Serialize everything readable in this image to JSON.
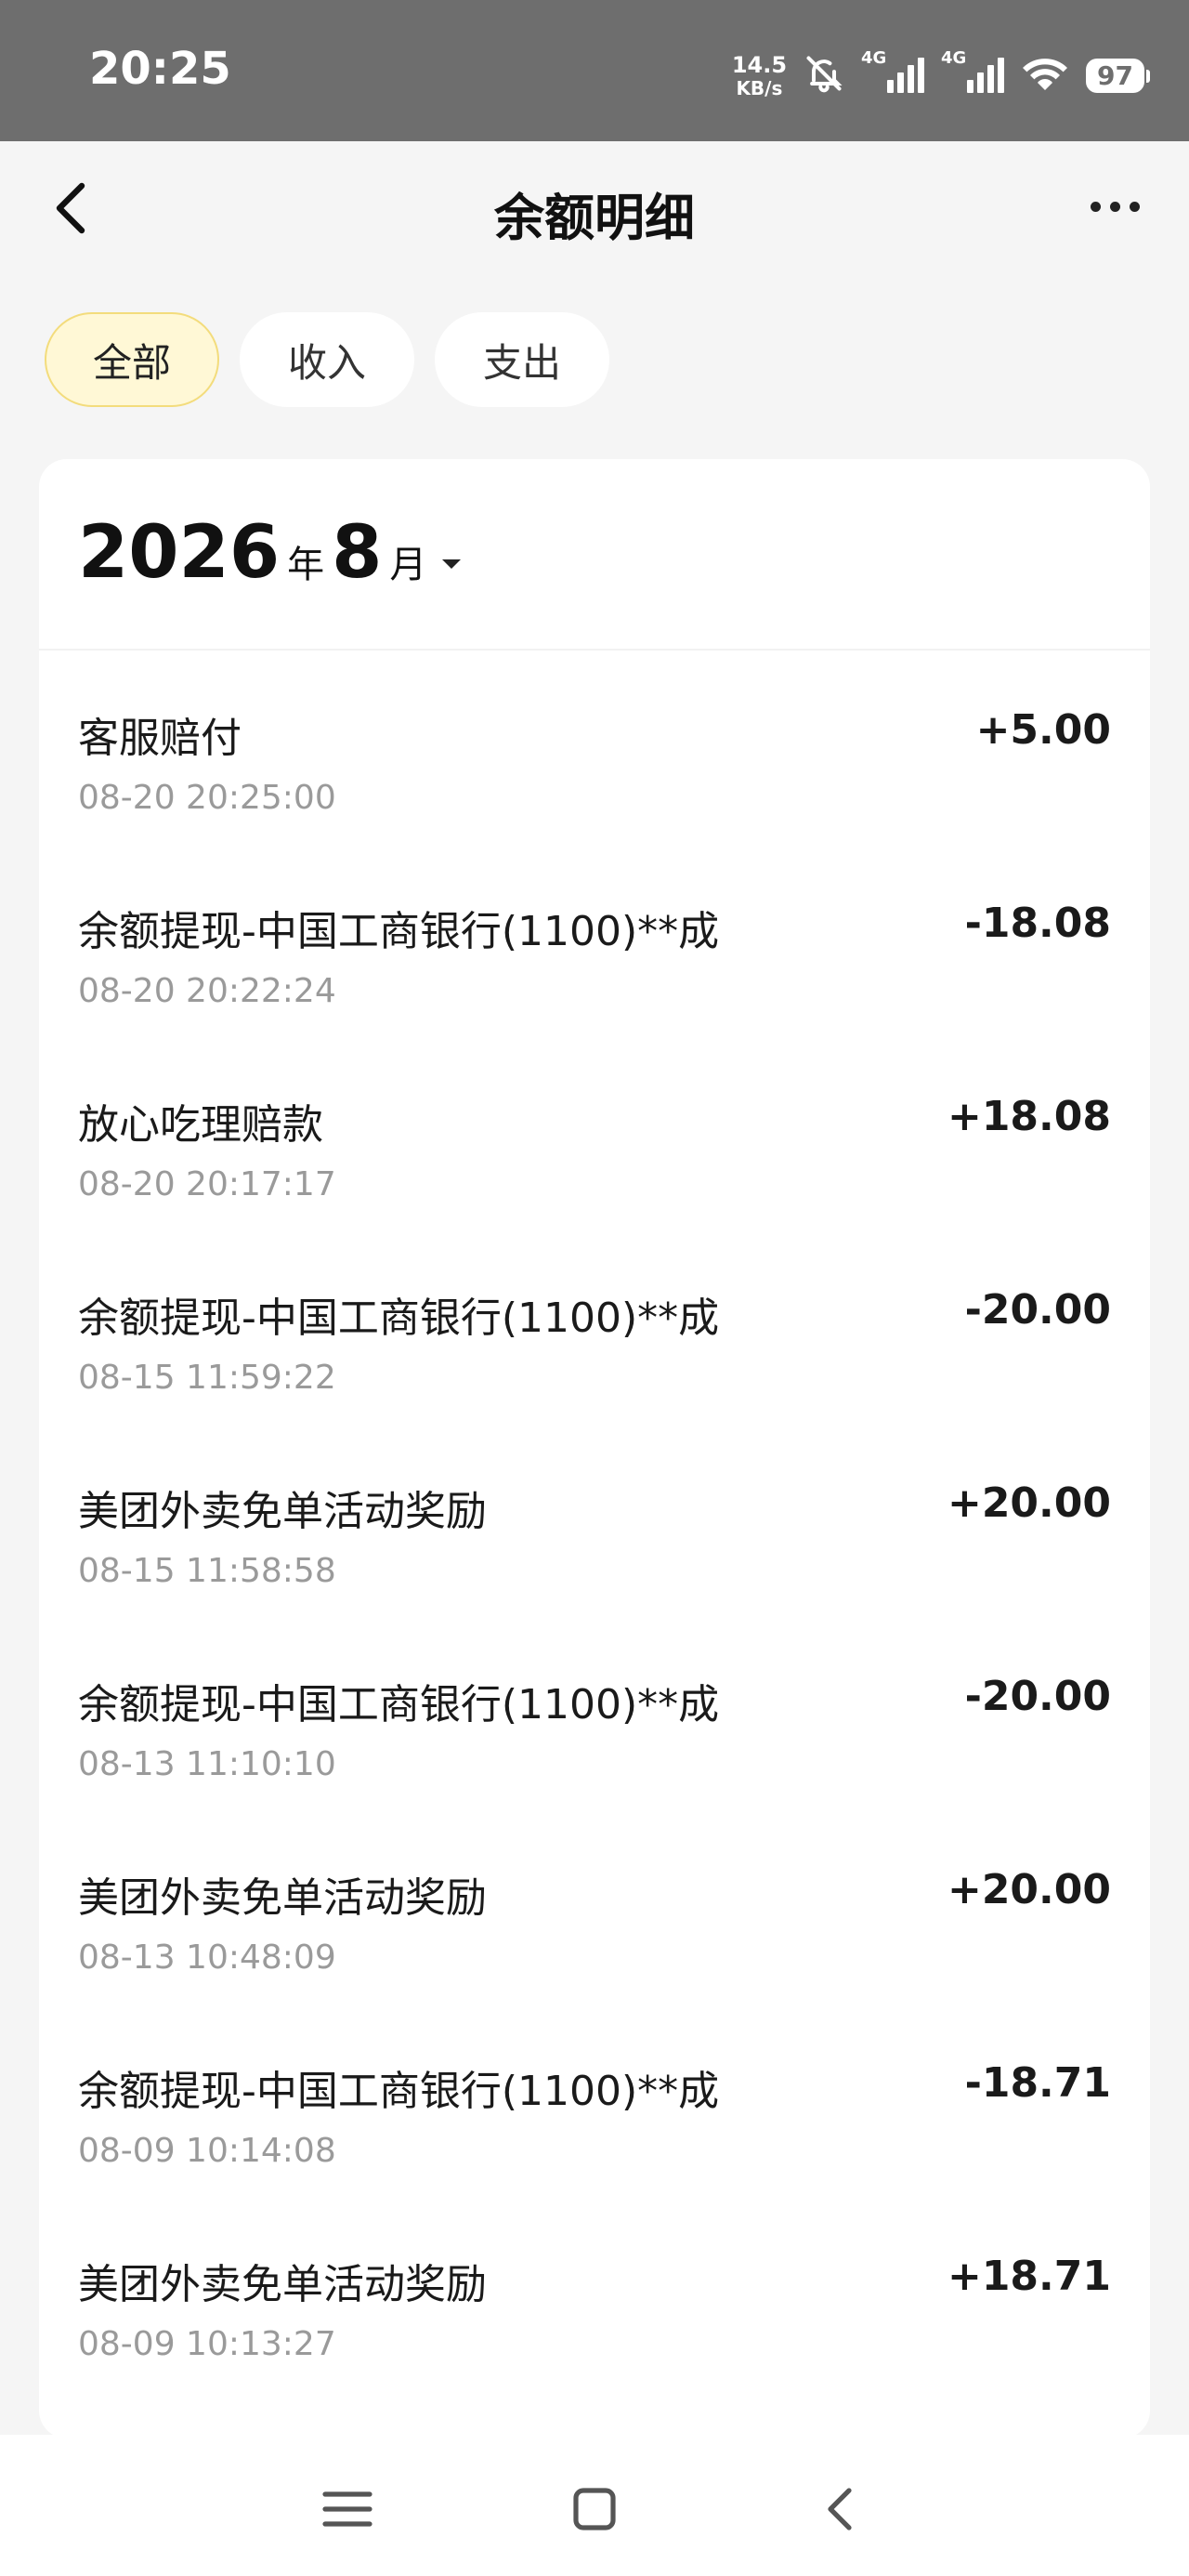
{
  "status_bar": {
    "time": "20:25",
    "net_speed_value": "14.5",
    "net_speed_unit": "KB/s",
    "sim1_label": "4G",
    "sim2_label": "4G",
    "battery": "97"
  },
  "header": {
    "title": "余额明细"
  },
  "tabs": [
    {
      "label": "全部",
      "active": true
    },
    {
      "label": "收入",
      "active": false
    },
    {
      "label": "支出",
      "active": false
    }
  ],
  "month_picker": {
    "year": "2026",
    "year_unit": "年",
    "month": "8",
    "month_unit": "月"
  },
  "transactions": [
    {
      "title": "客服赔付",
      "time": "08-20 20:25:00",
      "amount": "+5.00"
    },
    {
      "title": "余额提现-中国工商银行(1100)**成",
      "time": "08-20 20:22:24",
      "amount": "-18.08"
    },
    {
      "title": "放心吃理赔款",
      "time": "08-20 20:17:17",
      "amount": "+18.08"
    },
    {
      "title": "余额提现-中国工商银行(1100)**成",
      "time": "08-15 11:59:22",
      "amount": "-20.00"
    },
    {
      "title": "美团外卖免单活动奖励",
      "time": "08-15 11:58:58",
      "amount": "+20.00"
    },
    {
      "title": "余额提现-中国工商银行(1100)**成",
      "time": "08-13 11:10:10",
      "amount": "-20.00"
    },
    {
      "title": "美团外卖免单活动奖励",
      "time": "08-13 10:48:09",
      "amount": "+20.00"
    },
    {
      "title": "余额提现-中国工商银行(1100)**成",
      "time": "08-09 10:14:08",
      "amount": "-18.71"
    },
    {
      "title": "美团外卖免单活动奖励",
      "time": "08-09 10:13:27",
      "amount": "+18.71"
    }
  ],
  "icons": {
    "back": "chevron-left-icon",
    "more": "more-horizontal-icon",
    "caret": "caret-down-icon",
    "mute": "bell-off-icon",
    "wifi": "wifi-icon",
    "nav_menu": "menu-icon",
    "nav_home": "square-icon",
    "nav_back": "chevron-left-icon"
  },
  "colors": {
    "status_bar_bg": "#6e6e6e",
    "active_tab_bg": "#fff8d6",
    "active_tab_border": "#f3dc7c",
    "page_bg": "#f5f5f5"
  }
}
